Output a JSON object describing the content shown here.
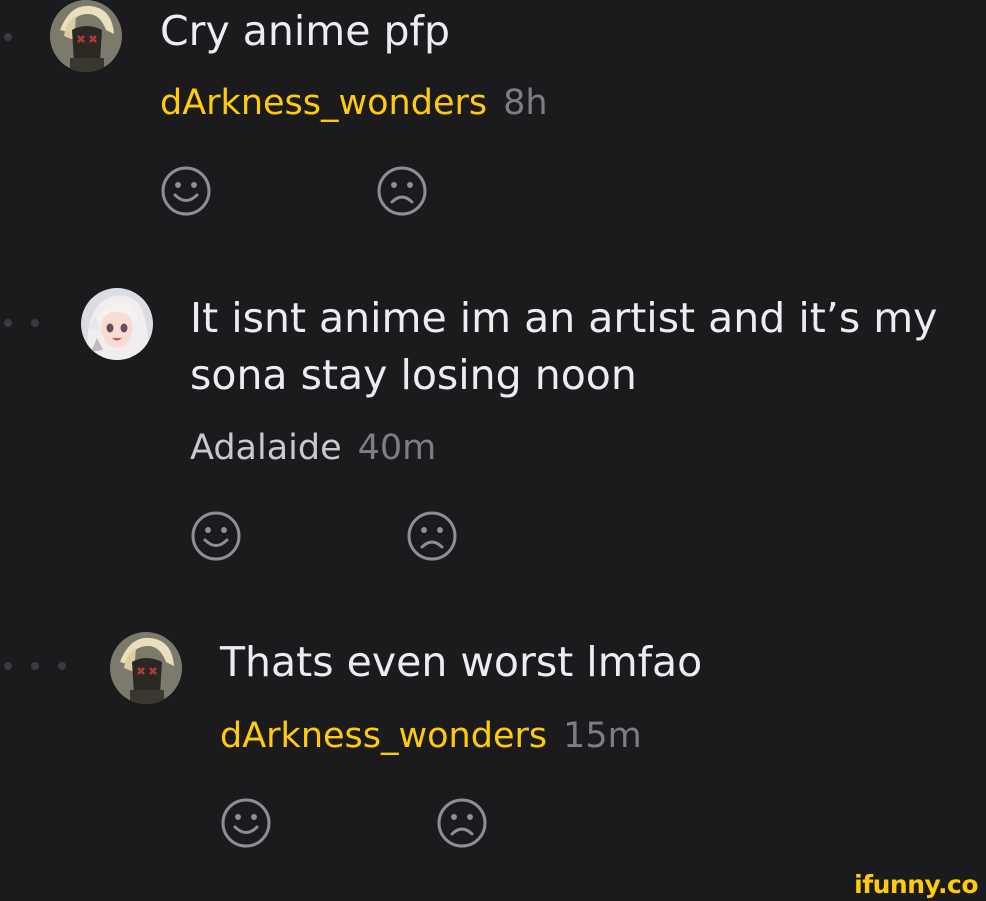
{
  "colors": {
    "background": "#1b1b1e",
    "text": "#ecedf0",
    "username_highlight": "#ffcb0a",
    "username_plain": "#c8c9cd",
    "timestamp": "#7d7e84",
    "reaction_icon": "#8e8f94"
  },
  "comments": [
    {
      "text": "Cry anime pfp",
      "author": "dArkness_wonders",
      "time": "8h",
      "avatar_icon": "masked-character-avatar",
      "reactions": [
        "smile-icon",
        "frown-icon"
      ]
    },
    {
      "text_line1": "It isnt anime im an artist and it’s my",
      "text_line2": "sona stay losing noon",
      "author": "Adalaide",
      "time": "40m",
      "avatar_icon": "anime-girl-avatar",
      "reactions": [
        "smile-icon",
        "frown-icon"
      ]
    },
    {
      "text": "Thats even worst lmfao",
      "author": "dArkness_wonders",
      "time": "15m",
      "avatar_icon": "masked-character-avatar",
      "reactions": [
        "smile-icon",
        "frown-icon"
      ]
    }
  ],
  "watermark": {
    "text": "ifunny.co"
  }
}
